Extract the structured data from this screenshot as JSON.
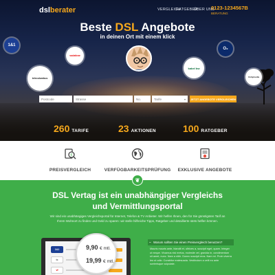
{
  "header": {
    "logo_a": "dsl",
    "logo_b": "berater",
    "nav": [
      "VERGLEICH",
      "RATGEBER",
      "ÜBER UNS"
    ],
    "phone": "0123-1234567B",
    "phone_sub": "BERATUNG"
  },
  "hero": {
    "title_a": "Beste ",
    "title_hl": "DSL",
    "title_b": " Angebote",
    "subtitle": "in deinen Ort mit einem klick",
    "brands": [
      "1&1",
      "vodafone",
      "telecolumbus",
      "O₂",
      "kabel bw",
      "Unitymedia"
    ],
    "search": {
      "plz": "Postcode",
      "strasse": "Strasse",
      "nr": "No.",
      "tarif": "Tarife",
      "button": "JETZT ANGEBOTE VERGLEICHEN"
    },
    "stats": [
      {
        "num": "260",
        "label": "TARIFE"
      },
      {
        "num": "23",
        "label": "AKTIONEN"
      },
      {
        "num": "100",
        "label": "RATGEBER"
      }
    ]
  },
  "features": [
    {
      "label": "PREISVERGLEICH",
      "icon": "price-compare-icon"
    },
    {
      "label": "VERFÜGBARKEITSPRÜFUNG",
      "icon": "globe-check-icon"
    },
    {
      "label": "EXKLUSIVE ANGEBOTE",
      "icon": "certificate-icon"
    }
  ],
  "about": {
    "title_1": "DSL Vertag ist ein unabhängiger Vergleichs",
    "title_2": "und Vermittlungsportal",
    "text": "Wir sind ein unabhängiges Vergleichsportal für Internet, Telefon & TV Anbieter. Wir helfen Ihnen, den für Sie günstigsten Tarif an Ihrem Wohnort zu finden und Geld zu sparen: wir stelle hilfreiche Tipps, Ratgeber und detaillierte stets helfen können.",
    "prices": [
      "9,90",
      "19,99"
    ],
    "price_unit": "€ mtl.",
    "faq_title": "Warum sollten Sie einen Preisvergleich benutzen?",
    "faq_text": "Mauris mauris ante, blandit et, ultrices a, suscipit eget, quam. Integer ut neque. Vivamus nisi metus, molestie vel, gravida in, condimentum sit amet, nunc. Nam a nibh. Donec suscipit eros. Nam mi. Proin viverra leo ut odio. Curabitur malesuada. Vestibulum a velit eu ante scelerisque vulputate."
  },
  "colors": {
    "accent": "#f6a81c",
    "green": "#3fae49"
  }
}
